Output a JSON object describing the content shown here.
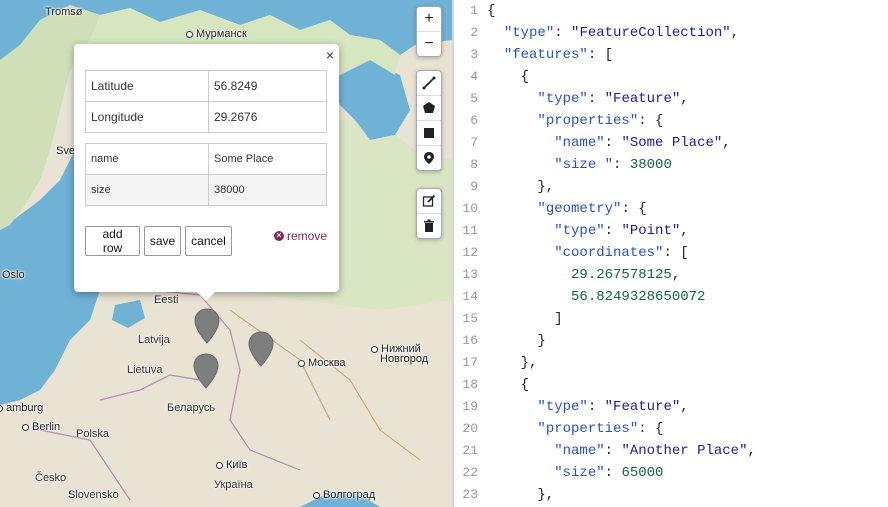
{
  "map": {
    "cities": [
      {
        "name": "Tromsø",
        "dot": false
      },
      {
        "name": "Мурманск",
        "dot": true
      },
      {
        "name": "Sve",
        "dot": false
      },
      {
        "name": "Oslo",
        "dot": false
      },
      {
        "name": "Eesti",
        "dot": false
      },
      {
        "name": "Latvija",
        "dot": false
      },
      {
        "name": "Lietuva",
        "dot": false
      },
      {
        "name": "Беларусь",
        "dot": false
      },
      {
        "name": "Москва",
        "dot": true
      },
      {
        "name": "Нижний",
        "dot": true
      },
      {
        "name": "Новгород",
        "dot": false
      },
      {
        "name": "amburg",
        "dot": true
      },
      {
        "name": "Berlin",
        "dot": true
      },
      {
        "name": "Polska",
        "dot": false
      },
      {
        "name": "Київ",
        "dot": true
      },
      {
        "name": "Україна",
        "dot": false
      },
      {
        "name": "Česko",
        "dot": false
      },
      {
        "name": "Slovensko",
        "dot": false
      },
      {
        "name": "Волгоград",
        "dot": true
      }
    ],
    "zoom_in": "+",
    "zoom_out": "−"
  },
  "popup": {
    "close": "×",
    "latitude_label": "Latitude",
    "latitude_value": "56.8249",
    "longitude_label": "Longitude",
    "longitude_value": "29.2676",
    "props": [
      {
        "key": "name",
        "value": "Some Place"
      },
      {
        "key": "size",
        "value": "38000"
      }
    ],
    "add_row": "add row",
    "save": "save",
    "cancel": "cancel",
    "remove": "remove"
  },
  "editor": {
    "lines": [
      [
        [
          "pun",
          "{"
        ]
      ],
      [
        [
          "pun",
          "  "
        ],
        [
          "key",
          "\"type\""
        ],
        [
          "pun",
          ": "
        ],
        [
          "str",
          "\"FeatureCollection\""
        ],
        [
          "pun",
          ","
        ]
      ],
      [
        [
          "pun",
          "  "
        ],
        [
          "key",
          "\"features\""
        ],
        [
          "pun",
          ": ["
        ]
      ],
      [
        [
          "pun",
          "    {"
        ]
      ],
      [
        [
          "pun",
          "      "
        ],
        [
          "key",
          "\"type\""
        ],
        [
          "pun",
          ": "
        ],
        [
          "str",
          "\"Feature\""
        ],
        [
          "pun",
          ","
        ]
      ],
      [
        [
          "pun",
          "      "
        ],
        [
          "key",
          "\"properties\""
        ],
        [
          "pun",
          ": {"
        ]
      ],
      [
        [
          "pun",
          "        "
        ],
        [
          "key",
          "\"name\""
        ],
        [
          "pun",
          ": "
        ],
        [
          "str",
          "\"Some Place\""
        ],
        [
          "pun",
          ","
        ]
      ],
      [
        [
          "pun",
          "        "
        ],
        [
          "key",
          "\"size \""
        ],
        [
          "pun",
          ": "
        ],
        [
          "num",
          "38000"
        ]
      ],
      [
        [
          "pun",
          "      },"
        ]
      ],
      [
        [
          "pun",
          "      "
        ],
        [
          "key",
          "\"geometry\""
        ],
        [
          "pun",
          ": {"
        ]
      ],
      [
        [
          "pun",
          "        "
        ],
        [
          "key",
          "\"type\""
        ],
        [
          "pun",
          ": "
        ],
        [
          "str",
          "\"Point\""
        ],
        [
          "pun",
          ","
        ]
      ],
      [
        [
          "pun",
          "        "
        ],
        [
          "key",
          "\"coordinates\""
        ],
        [
          "pun",
          ": ["
        ]
      ],
      [
        [
          "pun",
          "          "
        ],
        [
          "num",
          "29.267578125"
        ],
        [
          "pun",
          ","
        ]
      ],
      [
        [
          "pun",
          "          "
        ],
        [
          "num",
          "56.8249328650072"
        ]
      ],
      [
        [
          "pun",
          "        ]"
        ]
      ],
      [
        [
          "pun",
          "      }"
        ]
      ],
      [
        [
          "pun",
          "    },"
        ]
      ],
      [
        [
          "pun",
          "    {"
        ]
      ],
      [
        [
          "pun",
          "      "
        ],
        [
          "key",
          "\"type\""
        ],
        [
          "pun",
          ": "
        ],
        [
          "str",
          "\"Feature\""
        ],
        [
          "pun",
          ","
        ]
      ],
      [
        [
          "pun",
          "      "
        ],
        [
          "key",
          "\"properties\""
        ],
        [
          "pun",
          ": {"
        ]
      ],
      [
        [
          "pun",
          "        "
        ],
        [
          "key",
          "\"name\""
        ],
        [
          "pun",
          ": "
        ],
        [
          "str",
          "\"Another Place\""
        ],
        [
          "pun",
          ","
        ]
      ],
      [
        [
          "pun",
          "        "
        ],
        [
          "key",
          "\"size\""
        ],
        [
          "pun",
          ": "
        ],
        [
          "num",
          "65000"
        ]
      ],
      [
        [
          "pun",
          "      },"
        ]
      ]
    ]
  }
}
